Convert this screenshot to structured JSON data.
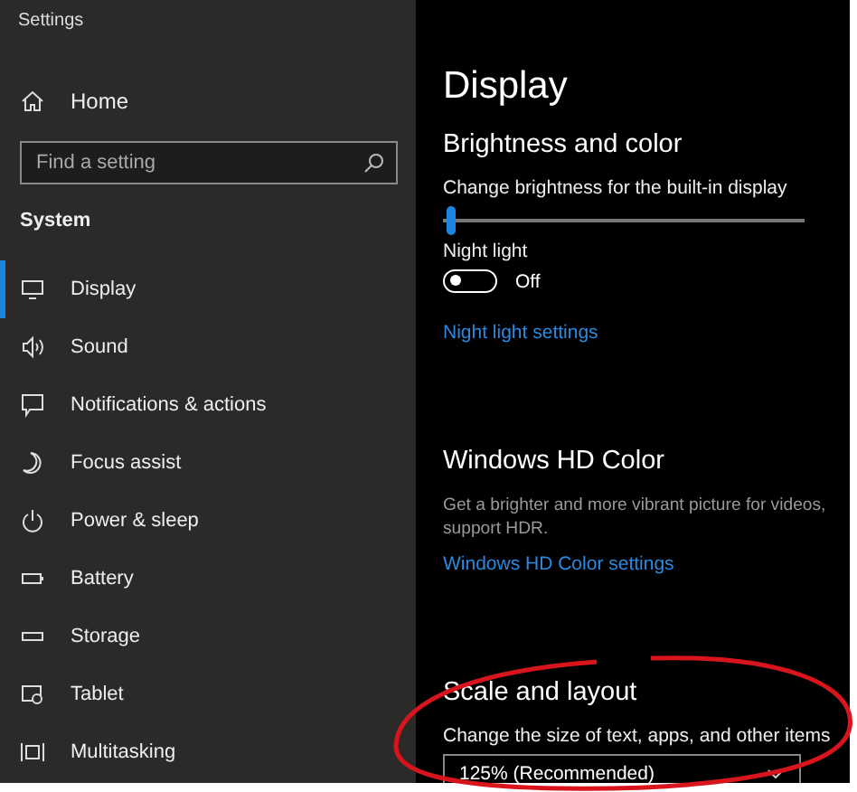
{
  "window": {
    "title": "Settings"
  },
  "sidebar": {
    "home": "Home",
    "search": {
      "placeholder": "Find a setting"
    },
    "section": "System",
    "items": [
      {
        "label": "Display",
        "selected": true
      },
      {
        "label": "Sound",
        "selected": false
      },
      {
        "label": "Notifications & actions",
        "selected": false
      },
      {
        "label": "Focus assist",
        "selected": false
      },
      {
        "label": "Power & sleep",
        "selected": false
      },
      {
        "label": "Battery",
        "selected": false
      },
      {
        "label": "Storage",
        "selected": false
      },
      {
        "label": "Tablet",
        "selected": false
      },
      {
        "label": "Multitasking",
        "selected": false
      }
    ]
  },
  "content": {
    "title": "Display",
    "sections": [
      {
        "heading": "Brightness and color",
        "items": [
          {
            "kind": "slider",
            "label": "Change brightness for the built-in display",
            "level": 0.01
          },
          {
            "kind": "toggle",
            "label": "Night light",
            "on": false,
            "state_text": "Off"
          },
          {
            "kind": "link",
            "label": "Night light settings"
          }
        ]
      },
      {
        "heading": "Windows HD Color",
        "items": [
          {
            "kind": "text",
            "label": "Get a brighter and more vibrant picture for videos,"
          },
          {
            "kind": "text",
            "label": "support HDR."
          },
          {
            "kind": "link",
            "label": "Windows HD Color settings"
          }
        ]
      },
      {
        "heading": "Scale and layout",
        "items": [
          {
            "kind": "dropdown",
            "label": "Change the size of text, apps, and other items",
            "value": "125% (Recommended)"
          }
        ]
      }
    ]
  },
  "annotation": {
    "kind": "ellipse",
    "color": "#d8141c"
  }
}
